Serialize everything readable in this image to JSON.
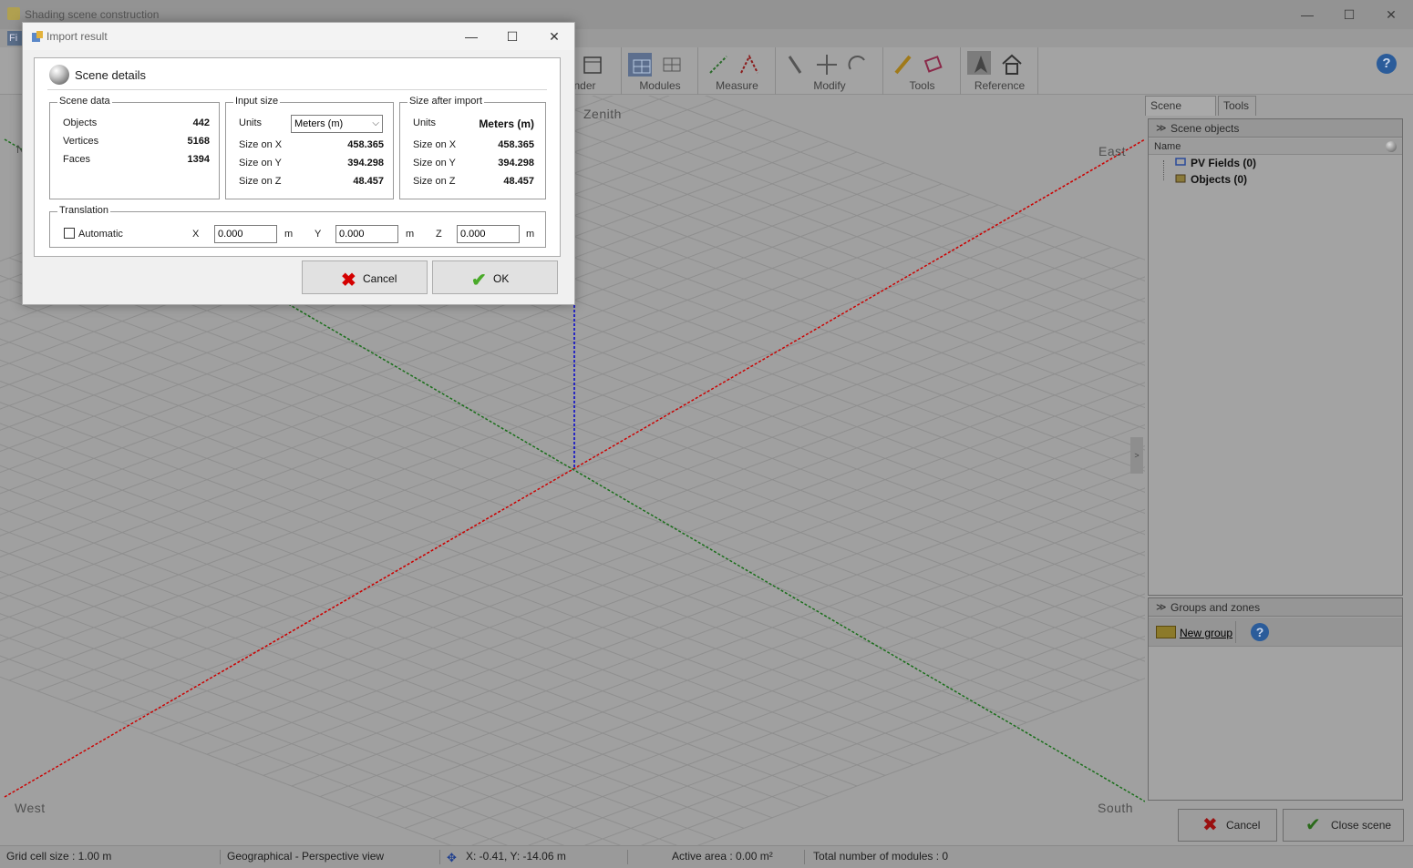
{
  "main_window": {
    "title": "Shading scene construction",
    "menu_first": "Fi",
    "toolbar_groups": [
      {
        "label": "nder"
      },
      {
        "label": "Modules"
      },
      {
        "label": "Measure"
      },
      {
        "label": "Modify"
      },
      {
        "label": "Tools"
      },
      {
        "label": "Reference"
      }
    ],
    "help_label": "?"
  },
  "viewport": {
    "compass": {
      "zenith": "Zenith",
      "east": "East",
      "west": "West",
      "south": "South",
      "north": "N"
    },
    "axis_colors": {
      "x": "#cc0000",
      "y": "#1a6e1a",
      "z": "#0000cc"
    },
    "collapse_handle": ">"
  },
  "right_panel": {
    "tabs": [
      "Scene objects",
      "Tools"
    ],
    "scene_objects": {
      "header": "Scene objects",
      "column_name": "Name",
      "items": [
        {
          "label": "PV Fields (0)",
          "icon": "pv-field-icon"
        },
        {
          "label": "Objects (0)",
          "icon": "object-box-icon"
        }
      ]
    },
    "groups": {
      "header": "Groups and zones",
      "new_group_label": "New group",
      "help_label": "?"
    },
    "cancel_label": "Cancel",
    "close_scene_label": "Close scene"
  },
  "statusbar": {
    "grid_cell": "Grid cell size :  1.00 m",
    "view_mode": "Geographical - Perspective view",
    "coords": "X: -0.41, Y: -14.06 m",
    "active_area": "Active area : 0.00 m²",
    "total_modules": "Total number of modules : 0"
  },
  "dialog": {
    "title": "Import result",
    "section_title": "Scene details",
    "scene_data": {
      "label": "Scene data",
      "rows": [
        {
          "label": "Objects",
          "value": "442"
        },
        {
          "label": "Vertices",
          "value": "5168"
        },
        {
          "label": "Faces",
          "value": "1394"
        }
      ]
    },
    "input_size": {
      "label": "Input size",
      "units_label": "Units",
      "units_value": "Meters (m)",
      "rows": [
        {
          "label": "Size on X",
          "value": "458.365"
        },
        {
          "label": "Size on Y",
          "value": "394.298"
        },
        {
          "label": "Size on Z",
          "value": "48.457"
        }
      ]
    },
    "size_after": {
      "label": "Size after import",
      "units_label": "Units",
      "units_value": "Meters (m)",
      "rows": [
        {
          "label": "Size on X",
          "value": "458.365"
        },
        {
          "label": "Size on Y",
          "value": "394.298"
        },
        {
          "label": "Size on Z",
          "value": "48.457"
        }
      ]
    },
    "translation": {
      "label": "Translation",
      "automatic_label": "Automatic",
      "automatic_checked": false,
      "x_label": "X",
      "x_value": "0.000",
      "y_label": "Y",
      "y_value": "0.000",
      "z_label": "Z",
      "z_value": "0.000",
      "unit": "m"
    },
    "cancel_label": "Cancel",
    "ok_label": "OK"
  }
}
